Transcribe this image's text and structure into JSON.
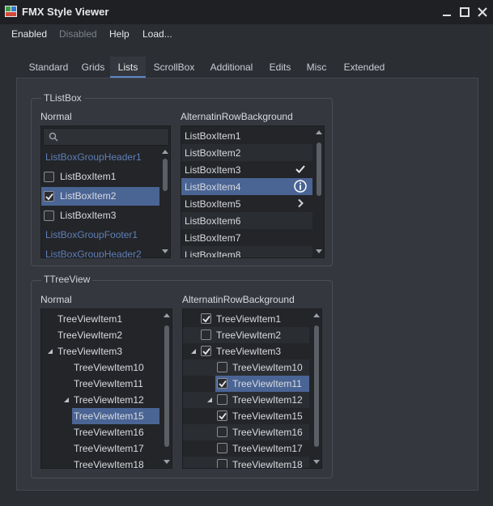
{
  "window": {
    "title": "FMX Style Viewer"
  },
  "menu": [
    "Enabled",
    "Disabled",
    "Help",
    "Load..."
  ],
  "tabs": [
    "Standard",
    "Grids",
    "Lists",
    "ScrollBox",
    "Additional",
    "Edits",
    "Misc",
    "Extended"
  ],
  "active_tab": "Lists",
  "listbox_group": {
    "title": "TListBox",
    "normal": {
      "label": "Normal",
      "rows": [
        {
          "text": "ListBoxGroupHeader1",
          "kind": "group"
        },
        {
          "text": "ListBoxItem1",
          "kind": "check",
          "checked": false
        },
        {
          "text": "ListBoxItem2",
          "kind": "check",
          "checked": true,
          "selected": true
        },
        {
          "text": "ListBoxItem3",
          "kind": "check",
          "checked": false
        },
        {
          "text": "ListBoxGroupFooter1",
          "kind": "group"
        },
        {
          "text": "ListBoxGroupHeader2",
          "kind": "group"
        }
      ]
    },
    "alt": {
      "label": "AlternatinRowBackground",
      "rows": [
        {
          "text": "ListBoxItem1"
        },
        {
          "text": "ListBoxItem2"
        },
        {
          "text": "ListBoxItem3",
          "accessory": "checkmark-icon"
        },
        {
          "text": "ListBoxItem4",
          "accessory": "info-icon",
          "selected": true
        },
        {
          "text": "ListBoxItem5",
          "accessory": "chevron-right-icon"
        },
        {
          "text": "ListBoxItem6"
        },
        {
          "text": "ListBoxItem7"
        },
        {
          "text": "ListBoxItem8"
        }
      ]
    }
  },
  "treeview_group": {
    "title": "TTreeView",
    "normal": {
      "label": "Normal",
      "rows": [
        {
          "text": "TreeViewItem1",
          "level": 0
        },
        {
          "text": "TreeViewItem2",
          "level": 0
        },
        {
          "text": "TreeViewItem3",
          "level": 0,
          "expanded": true
        },
        {
          "text": "TreeViewItem10",
          "level": 1
        },
        {
          "text": "TreeViewItem11",
          "level": 1
        },
        {
          "text": "TreeViewItem12",
          "level": 1,
          "expanded": true
        },
        {
          "text": "TreeViewItem15",
          "level": 1,
          "selected": true
        },
        {
          "text": "TreeViewItem16",
          "level": 1
        },
        {
          "text": "TreeViewItem17",
          "level": 1
        },
        {
          "text": "TreeViewItem18",
          "level": 1
        }
      ]
    },
    "alt": {
      "label": "AlternatinRowBackground",
      "rows": [
        {
          "text": "TreeViewItem1",
          "level": 0,
          "checked": true
        },
        {
          "text": "TreeViewItem2",
          "level": 0,
          "checked": false
        },
        {
          "text": "TreeViewItem3",
          "level": 0,
          "checked": true,
          "expanded": true
        },
        {
          "text": "TreeViewItem10",
          "level": 1,
          "checked": false
        },
        {
          "text": "TreeViewItem11",
          "level": 1,
          "checked": true,
          "selected": true
        },
        {
          "text": "TreeViewItem12",
          "level": 1,
          "checked": false,
          "expanded": true
        },
        {
          "text": "TreeViewItem15",
          "level": 1,
          "checked": true
        },
        {
          "text": "TreeViewItem16",
          "level": 1,
          "checked": false
        },
        {
          "text": "TreeViewItem17",
          "level": 1,
          "checked": false
        },
        {
          "text": "TreeViewItem18",
          "level": 1,
          "checked": false
        }
      ]
    }
  },
  "colors": {
    "accent": "#5d86c9",
    "selection": "#4a6494",
    "group_text": "#5f7fb8"
  }
}
